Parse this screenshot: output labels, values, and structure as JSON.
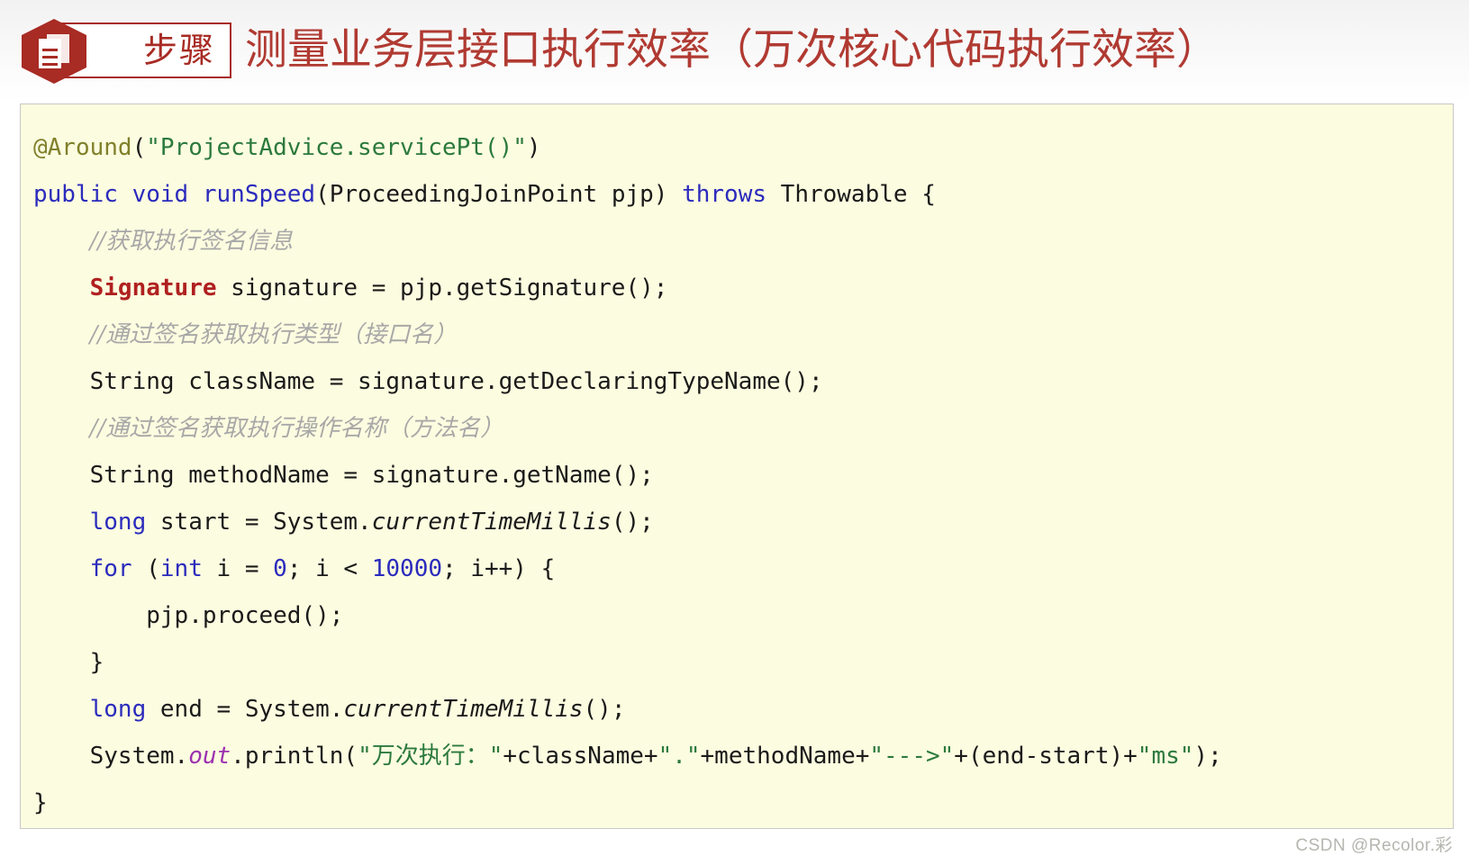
{
  "header": {
    "badge_label": "步骤",
    "badge_icon": "document-icon",
    "title": "测量业务层接口执行效率（万次核心代码执行效率）",
    "accent_color": "#a82b24",
    "title_color": "#b03a32"
  },
  "code_block": {
    "background_color": "#fcfce0",
    "border_color": "#c9c9c9",
    "language": "java",
    "lines": [
      {
        "indent": 0,
        "tokens": [
          {
            "t": "@Around",
            "c": "ann"
          },
          {
            "t": "(",
            "c": "plain"
          },
          {
            "t": "\"ProjectAdvice.servicePt()\"",
            "c": "str"
          },
          {
            "t": ")",
            "c": "plain"
          }
        ]
      },
      {
        "indent": 0,
        "tokens": [
          {
            "t": "public",
            "c": "kw"
          },
          {
            "t": " ",
            "c": "plain"
          },
          {
            "t": "void",
            "c": "kw"
          },
          {
            "t": " ",
            "c": "plain"
          },
          {
            "t": "runSpeed",
            "c": "kw"
          },
          {
            "t": "(ProceedingJoinPoint pjp) ",
            "c": "plain"
          },
          {
            "t": "throws",
            "c": "kw"
          },
          {
            "t": " Throwable {",
            "c": "plain"
          }
        ]
      },
      {
        "indent": 1,
        "tokens": [
          {
            "t": "//获取执行签名信息",
            "c": "cmt"
          }
        ]
      },
      {
        "indent": 1,
        "tokens": [
          {
            "t": "Signature",
            "c": "type-hl"
          },
          {
            "t": " signature = pjp.getSignature();",
            "c": "plain"
          }
        ]
      },
      {
        "indent": 1,
        "tokens": [
          {
            "t": "//通过签名获取执行类型（接口名）",
            "c": "cmt"
          }
        ]
      },
      {
        "indent": 1,
        "tokens": [
          {
            "t": "String className = signature.getDeclaringTypeName();",
            "c": "plain"
          }
        ]
      },
      {
        "indent": 1,
        "tokens": [
          {
            "t": "//通过签名获取执行操作名称（方法名）",
            "c": "cmt"
          }
        ]
      },
      {
        "indent": 1,
        "tokens": [
          {
            "t": "String methodName = signature.getName();",
            "c": "plain"
          }
        ]
      },
      {
        "indent": 1,
        "tokens": [
          {
            "t": "long",
            "c": "kw"
          },
          {
            "t": " start = System.",
            "c": "plain"
          },
          {
            "t": "currentTimeMillis",
            "c": "stat"
          },
          {
            "t": "();",
            "c": "plain"
          }
        ]
      },
      {
        "indent": 1,
        "tokens": [
          {
            "t": "for",
            "c": "kw"
          },
          {
            "t": " (",
            "c": "plain"
          },
          {
            "t": "int",
            "c": "kw"
          },
          {
            "t": " i = ",
            "c": "plain"
          },
          {
            "t": "0",
            "c": "num"
          },
          {
            "t": "; i < ",
            "c": "plain"
          },
          {
            "t": "10000",
            "c": "num"
          },
          {
            "t": "; i++) {",
            "c": "plain"
          }
        ]
      },
      {
        "indent": 2,
        "tokens": [
          {
            "t": "pjp.proceed();",
            "c": "plain"
          }
        ]
      },
      {
        "indent": 1,
        "tokens": [
          {
            "t": "}",
            "c": "plain"
          }
        ]
      },
      {
        "indent": 1,
        "tokens": [
          {
            "t": "long",
            "c": "kw"
          },
          {
            "t": " end = System.",
            "c": "plain"
          },
          {
            "t": "currentTimeMillis",
            "c": "stat"
          },
          {
            "t": "();",
            "c": "plain"
          }
        ]
      },
      {
        "indent": 1,
        "tokens": [
          {
            "t": "System.",
            "c": "plain"
          },
          {
            "t": "out",
            "c": "field"
          },
          {
            "t": ".println(",
            "c": "plain"
          },
          {
            "t": "\"万次执行：\"",
            "c": "str"
          },
          {
            "t": "+className+",
            "c": "plain"
          },
          {
            "t": "\".\"",
            "c": "str"
          },
          {
            "t": "+methodName+",
            "c": "plain"
          },
          {
            "t": "\"--->\"",
            "c": "str"
          },
          {
            "t": "+(end-start)+",
            "c": "plain"
          },
          {
            "t": "\"ms\"",
            "c": "str"
          },
          {
            "t": ");",
            "c": "plain"
          }
        ]
      },
      {
        "indent": 0,
        "tokens": [
          {
            "t": "}",
            "c": "plain"
          }
        ]
      }
    ]
  },
  "watermark": {
    "text": "CSDN @Recolor.彩"
  }
}
